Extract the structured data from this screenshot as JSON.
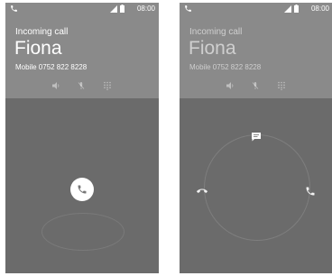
{
  "left_screen": {
    "status": {
      "time": "08:00"
    },
    "call": {
      "label": "Incoming call",
      "name": "Fiona",
      "number": "Mobile 0752 822 8228"
    },
    "controls": [
      "speaker-icon",
      "mute-icon",
      "dialpad-icon"
    ],
    "answer_icon": "phone-icon"
  },
  "right_screen": {
    "status": {
      "time": "08:00"
    },
    "call": {
      "label": "Incoming call",
      "name": "Fiona",
      "number": "Mobile 0752 822 8228"
    },
    "controls": [
      "speaker-icon",
      "mute-icon",
      "dialpad-icon"
    ],
    "ring_actions": [
      "message-icon",
      "decline-call-icon",
      "answer-call-icon"
    ]
  },
  "colors": {
    "header": "#8a8a8a",
    "body": "#6b6b6b",
    "text": "#ffffff",
    "answer_icon": "#777777"
  }
}
